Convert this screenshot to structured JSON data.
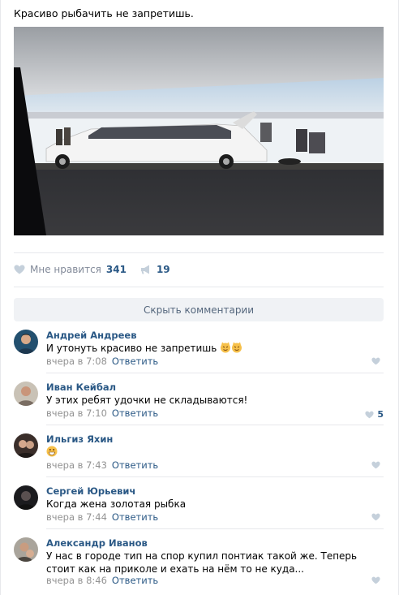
{
  "post": {
    "text": "Красиво рыбачить не запретишь."
  },
  "actions": {
    "like_label": "Мне нравится",
    "like_count": "341",
    "share_count": "19"
  },
  "comments_toggle": "Скрыть комментарии",
  "comments": [
    {
      "author": "Андрей Андреев",
      "text": "И утонуть красиво не запретишь",
      "time": "вчера в 7:08",
      "reply": "Ответить",
      "likes": ""
    },
    {
      "author": "Иван Кейбал",
      "text": "У этих ребят удочки не складываются!",
      "time": "вчера в 7:10",
      "reply": "Ответить",
      "likes": "5"
    },
    {
      "author": "Ильгиз Яхин",
      "text": "",
      "time": "вчера в 7:43",
      "reply": "Ответить",
      "likes": ""
    },
    {
      "author": "Сергей Юрьевич",
      "text": "Когда жена золотая рыбка",
      "time": "вчера в 7:44",
      "reply": "Ответить",
      "likes": ""
    },
    {
      "author": "Александр Иванов",
      "text": "У нас в городе тип на спор купил понтиак такой же. Теперь стоит как на приколе и ехать на нём то не куда...",
      "time": "вчера в 8:46",
      "reply": "Ответить",
      "likes": ""
    }
  ],
  "colors": {
    "link": "#2a5885",
    "muted": "#939393",
    "divider": "#e7e8ec",
    "button_bg": "#f0f2f5"
  }
}
